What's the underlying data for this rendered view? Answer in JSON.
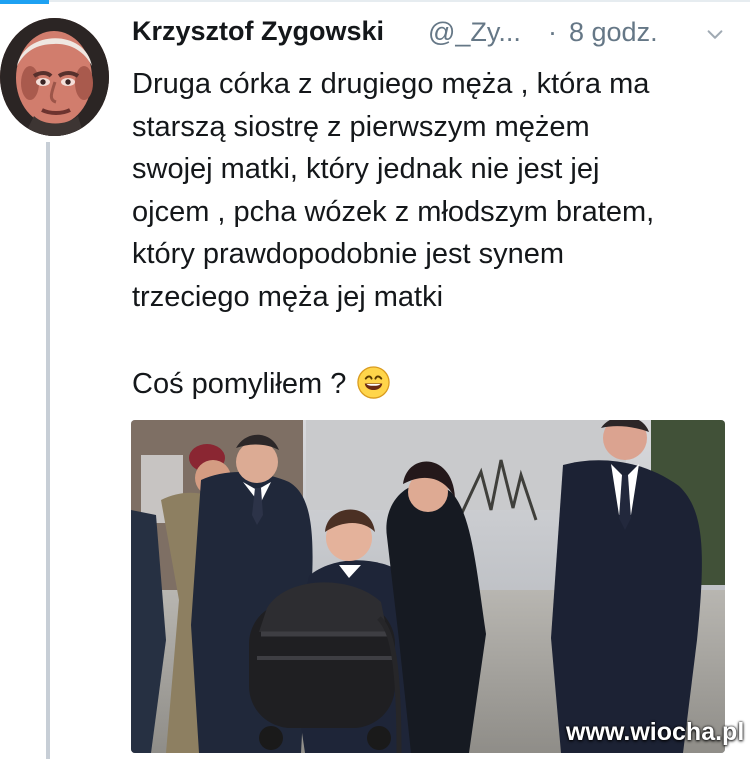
{
  "tweet": {
    "display_name": "Krzysztof Zygowski",
    "handle": "@_Zy...",
    "separator": "·",
    "timestamp": "8 godz.",
    "body_lines": [
      "Druga córka z drugiego męża , która ma",
      "starszą siostrę z pierwszym mężem",
      "swojej matki, który jednak nie jest jej",
      "ojcem , pcha wózek z młodszym bratem,",
      "który prawdopodobnie jest synem",
      "trzeciego męża jej matki"
    ],
    "question": "Coś pomyliłem ?",
    "emoji": "grinning-face-with-smiling-eyes",
    "watermark": "www.wiocha.pl"
  },
  "icons": {
    "menu": "chevron-down-icon"
  },
  "colors": {
    "text": "#14171a",
    "muted": "#657786",
    "accent": "#1da1f2",
    "thread_line": "#c7ced6"
  }
}
